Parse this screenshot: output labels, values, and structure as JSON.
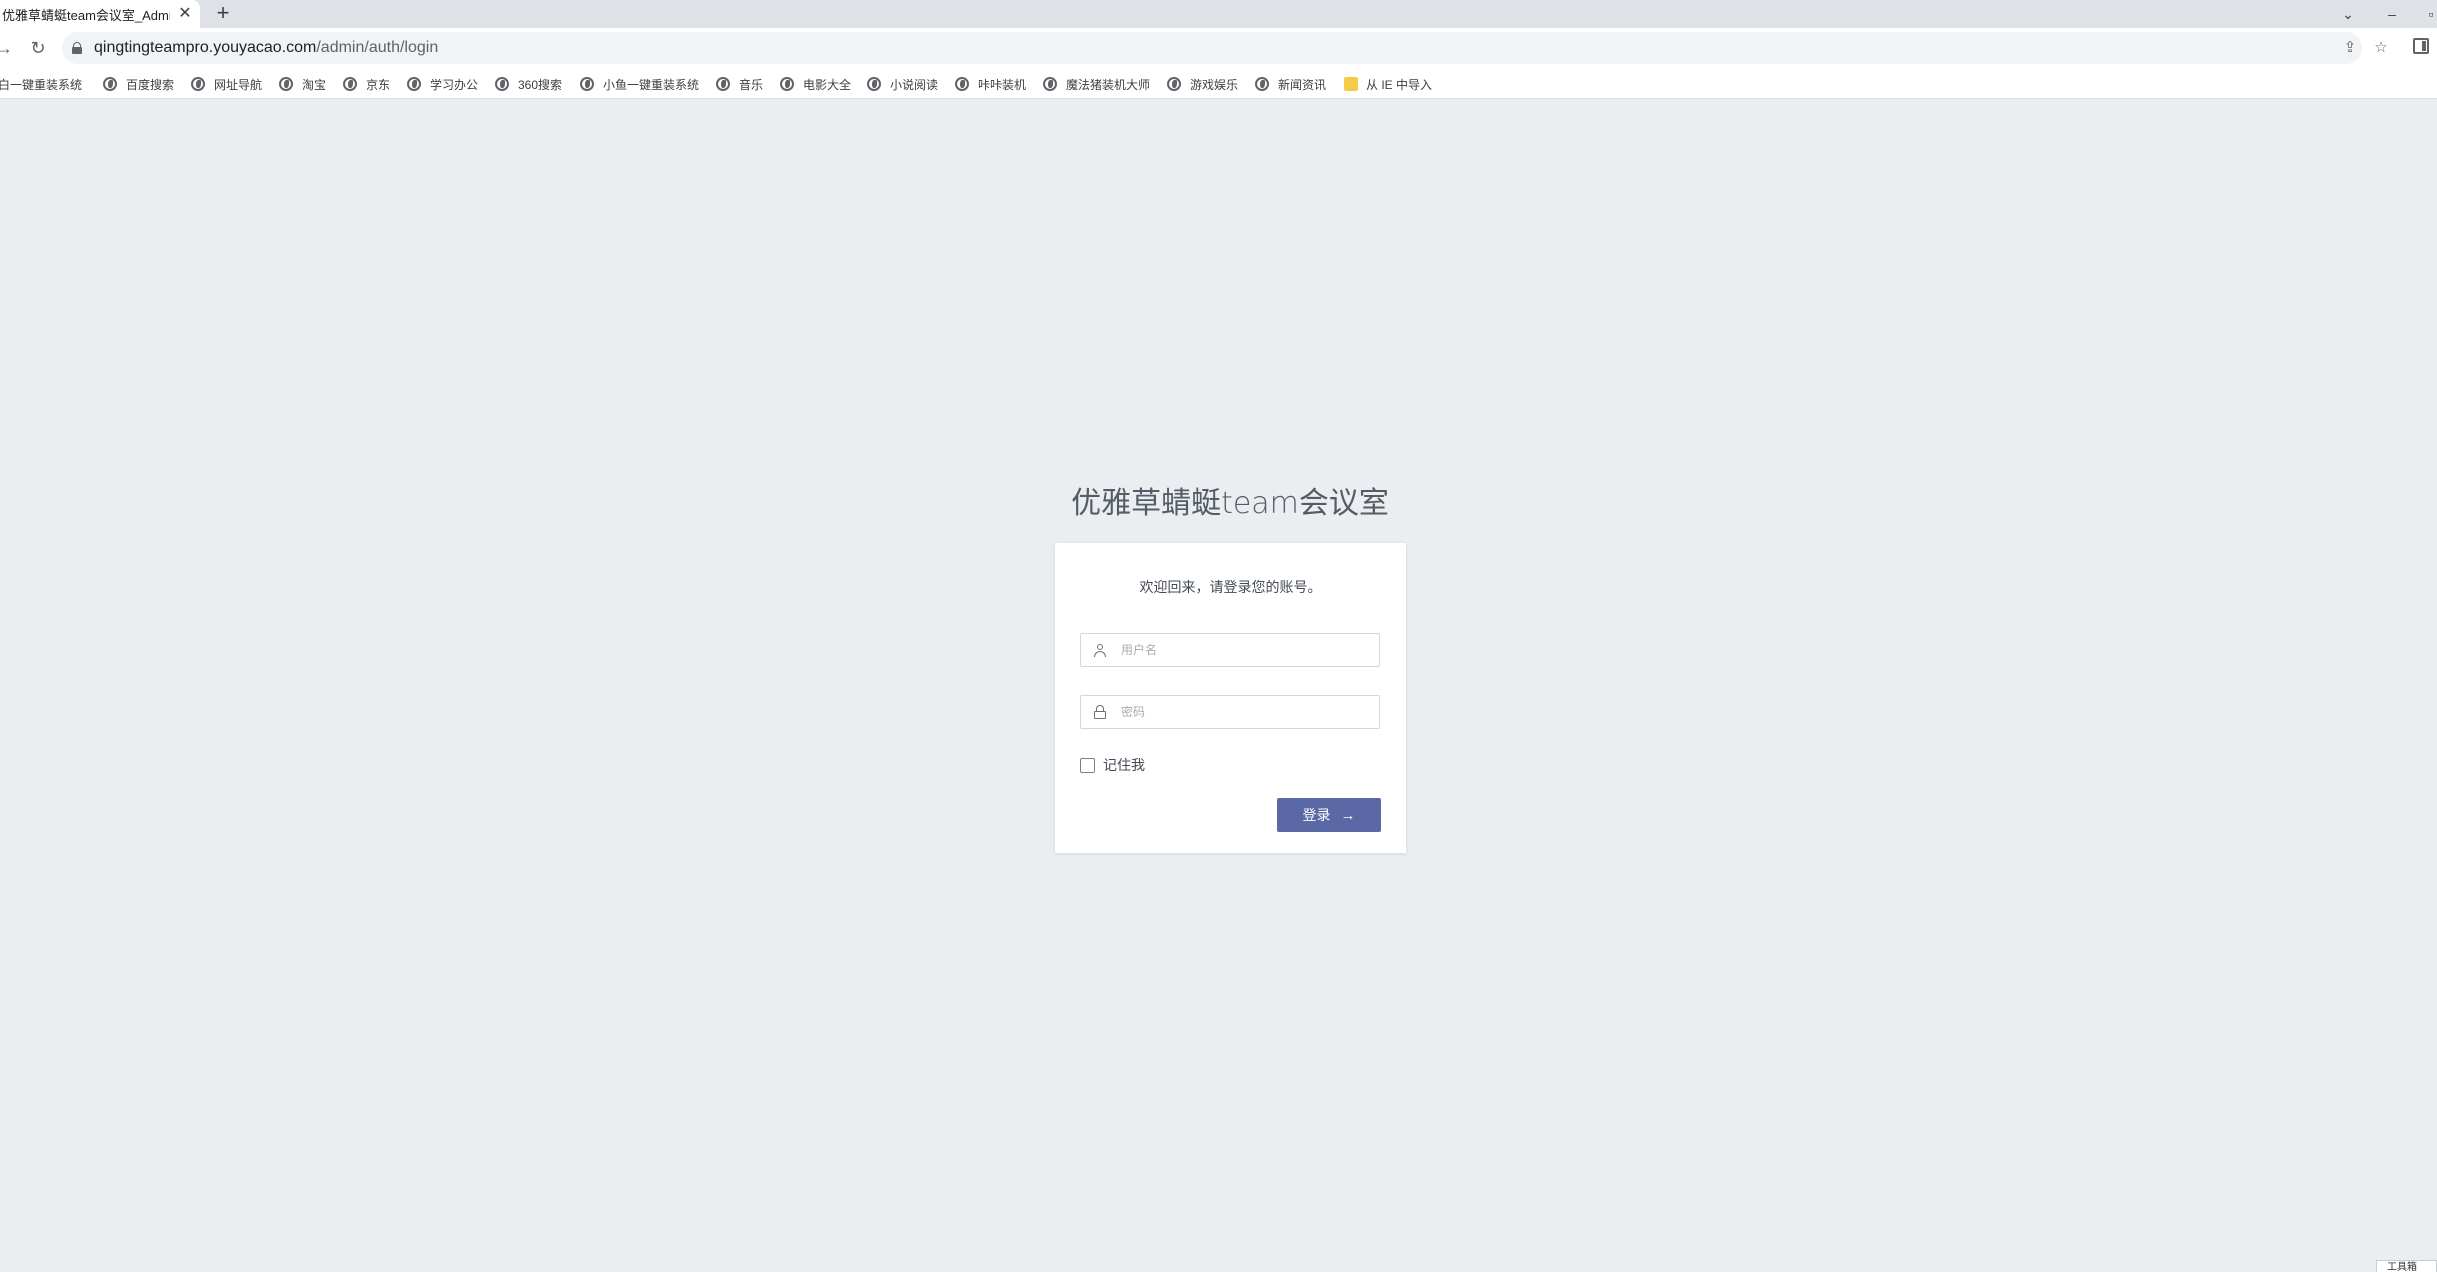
{
  "browser": {
    "tab_title": "优雅草蜻蜓team会议室_Admin",
    "tab_close": "✕",
    "new_tab": "+",
    "url_host": "qingtingteampro.youyacao.com",
    "url_path": "/admin/auth/login"
  },
  "bookmarks": [
    {
      "label": "白一键重装系统",
      "icon": "globe-icon"
    },
    {
      "label": "百度搜索",
      "icon": "globe-icon"
    },
    {
      "label": "网址导航",
      "icon": "globe-icon"
    },
    {
      "label": "淘宝",
      "icon": "globe-icon"
    },
    {
      "label": "京东",
      "icon": "globe-icon"
    },
    {
      "label": "学习办公",
      "icon": "globe-icon"
    },
    {
      "label": "360搜索",
      "icon": "globe-icon"
    },
    {
      "label": "小鱼一键重装系统",
      "icon": "globe-icon"
    },
    {
      "label": "音乐",
      "icon": "globe-icon"
    },
    {
      "label": "电影大全",
      "icon": "globe-icon"
    },
    {
      "label": "小说阅读",
      "icon": "globe-icon"
    },
    {
      "label": "咔咔装机",
      "icon": "globe-icon"
    },
    {
      "label": "魔法猪装机大师",
      "icon": "globe-icon"
    },
    {
      "label": "游戏娱乐",
      "icon": "globe-icon"
    },
    {
      "label": "新闻资讯",
      "icon": "globe-icon"
    },
    {
      "label": "从 IE 中导入",
      "icon": "folder-icon"
    }
  ],
  "login": {
    "app_title": "优雅草蜻蜓team会议室",
    "welcome": "欢迎回来，请登录您的账号。",
    "username_placeholder": "用户名",
    "password_placeholder": "密码",
    "remember_label": "记住我",
    "submit_label": "登录",
    "submit_icon": "→"
  },
  "corner_widget": "工具箱",
  "colors": {
    "page_bg": "#eaeef1",
    "button_bg": "#5a69a6"
  }
}
